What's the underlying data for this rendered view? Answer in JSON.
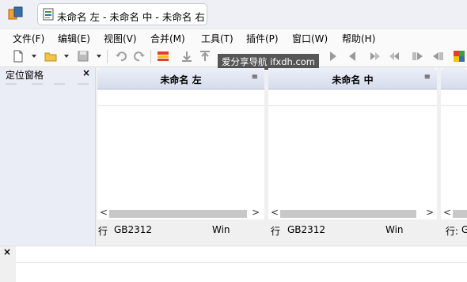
{
  "window": {
    "tab_title": "未命名 左 - 未命名 中 - 未命名 右"
  },
  "menu": {
    "items": [
      "文件(F)",
      "编辑(E)",
      "视图(V)",
      "合并(M)",
      "工具(T)",
      "插件(P)",
      "窗口(W)",
      "帮助(H)"
    ]
  },
  "toolbar": {
    "icons": [
      "new-file-icon",
      "open-folder-icon",
      "save-icon",
      "undo-icon",
      "redo-icon",
      "compare-icon",
      "merge-down-icon",
      "merge-up-icon",
      "next-diff-icon",
      "prev-diff-icon",
      "copy-right-icon",
      "copy-left-icon",
      "color-grid-icon"
    ]
  },
  "watermark": "爱分享导航 ifxdh.com",
  "locator": {
    "title": "定位窗格",
    "close": "×"
  },
  "panes": [
    {
      "title": "未命名 左",
      "menu": "≡",
      "status_line": "行",
      "status_encoding": "GB2312",
      "status_eol": "Win"
    },
    {
      "title": "未命名 中",
      "menu": "≡",
      "status_line": "行",
      "status_encoding": "GB2312",
      "status_eol": "Win"
    },
    {
      "title": "",
      "menu": "",
      "status_line": "行:",
      "status_encoding": "G",
      "status_eol": ""
    }
  ],
  "scroll": {
    "left": "<",
    "right": ">"
  },
  "bottom_panel": {
    "close": "×"
  },
  "colors": {
    "accent": "#3a6ea5",
    "header": "#d7dced",
    "locator_bg": "#eaedf6"
  }
}
